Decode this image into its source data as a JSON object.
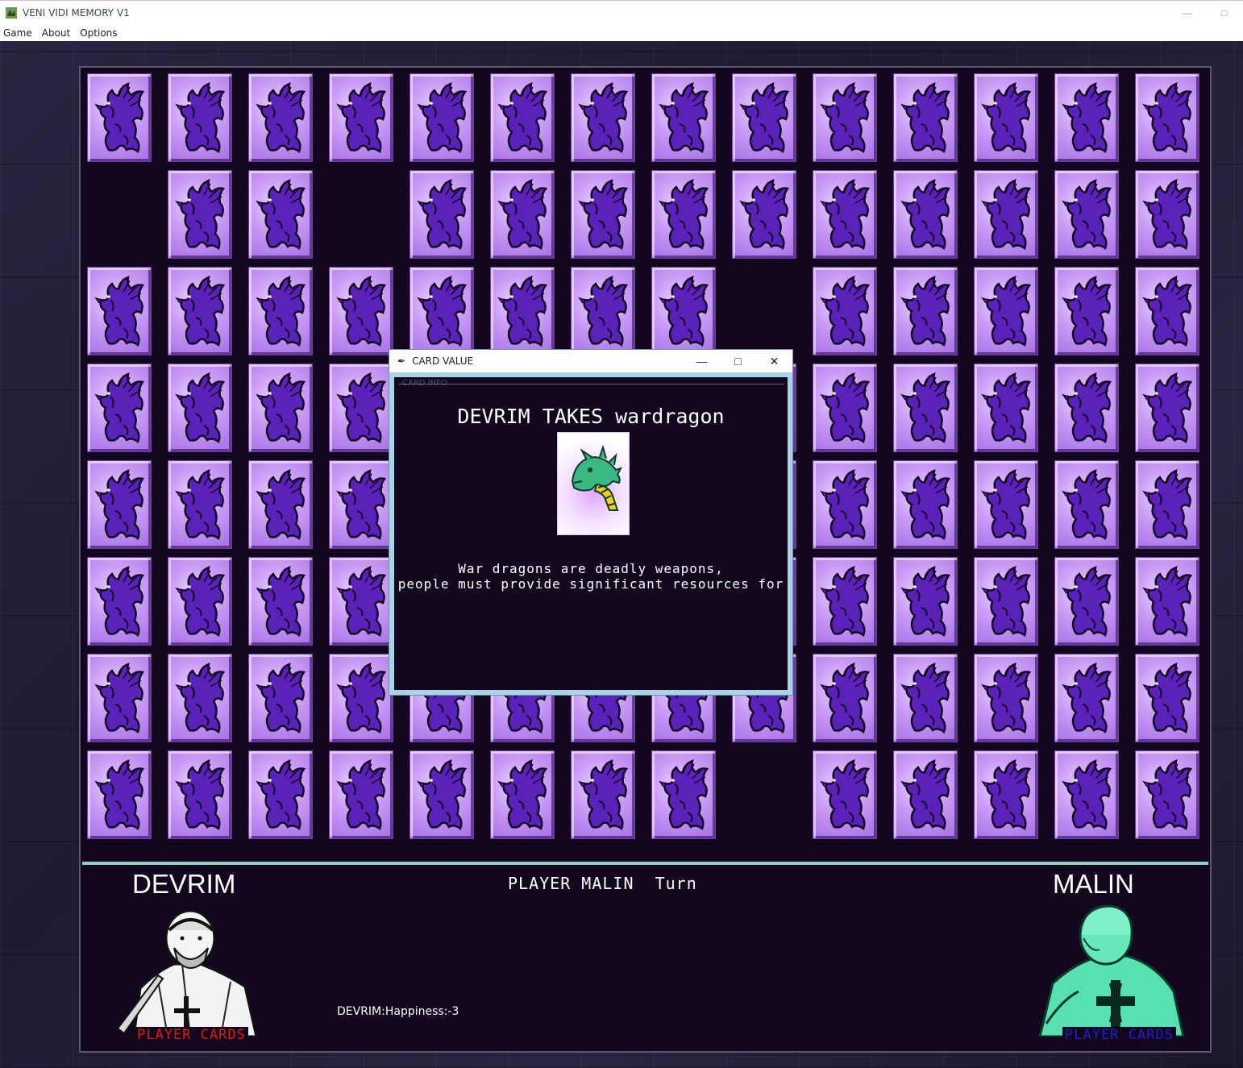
{
  "window": {
    "title": "VENI VIDI MEMORY V1"
  },
  "menu": [
    {
      "label": "Game"
    },
    {
      "label": "About"
    },
    {
      "label": "Options"
    }
  ],
  "board": {
    "rows": 8,
    "cols": 14,
    "card_back_icon": "purple-dragon-icon",
    "empty_slots": [
      [
        1,
        0
      ],
      [
        1,
        3
      ],
      [
        2,
        8
      ],
      [
        7,
        8
      ]
    ]
  },
  "players": {
    "left": {
      "name": "DEVRIM",
      "cards_label": "PLAYER CARDS",
      "cards_color": "#e01818"
    },
    "right": {
      "name": "MALIN",
      "cards_label": "PLAYER CARDS",
      "cards_color": "#2020c8"
    }
  },
  "turn_text": "PLAYER MALIN  Turn",
  "status_text": "DEVRIM:Happiness:-3",
  "dialog": {
    "title": "CARD VALUE",
    "frame_label": "CARD INFO",
    "heading": "DEVRIM TAKES wardragon",
    "card_icon": "green-dragon-head-icon",
    "desc_line1": "War dragons are deadly weapons,",
    "desc_line2": "people must provide significant resources for"
  },
  "colors": {
    "board_bg": "#13061f",
    "divider": "#8fd0c0",
    "card_back": "#c99af5"
  }
}
